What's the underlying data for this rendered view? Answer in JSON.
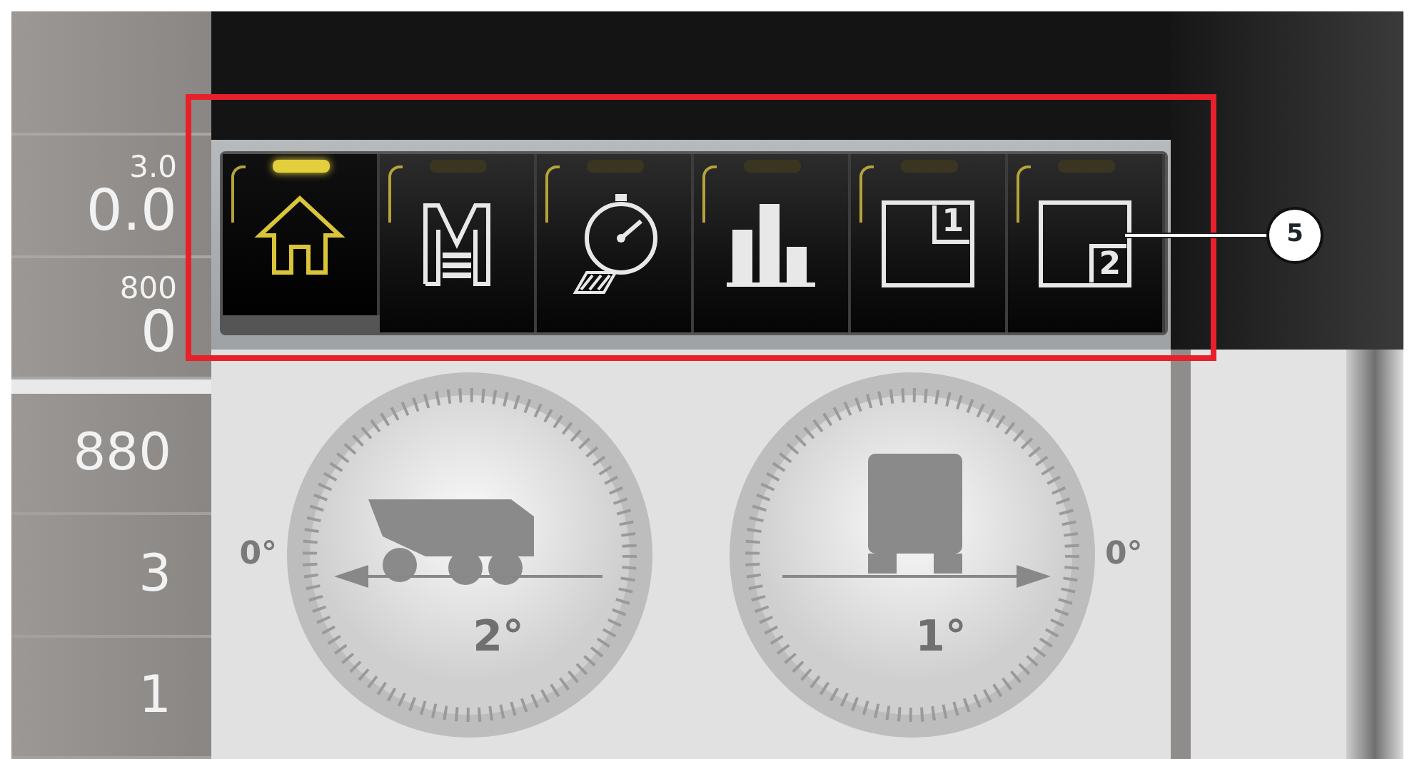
{
  "side_panel": {
    "readouts": [
      {
        "caption": "3.0",
        "value": "0.0"
      },
      {
        "caption": "800",
        "value": "0"
      }
    ],
    "rows": [
      "880",
      "3",
      "1"
    ]
  },
  "toolbar": {
    "tabs": [
      {
        "kind": "home",
        "selected": true
      },
      {
        "kind": "memory",
        "selected": false
      },
      {
        "kind": "stopwatch",
        "selected": false
      },
      {
        "kind": "chart",
        "selected": false
      },
      {
        "kind": "window",
        "number": "1",
        "selected": false
      },
      {
        "kind": "window",
        "number": "2",
        "selected": false
      }
    ]
  },
  "dials": [
    {
      "kind": "pitch",
      "zero_label": "0°",
      "value": "2°"
    },
    {
      "kind": "roll",
      "zero_label": "0°",
      "value": "1°"
    }
  ],
  "callout": {
    "label": "5"
  }
}
